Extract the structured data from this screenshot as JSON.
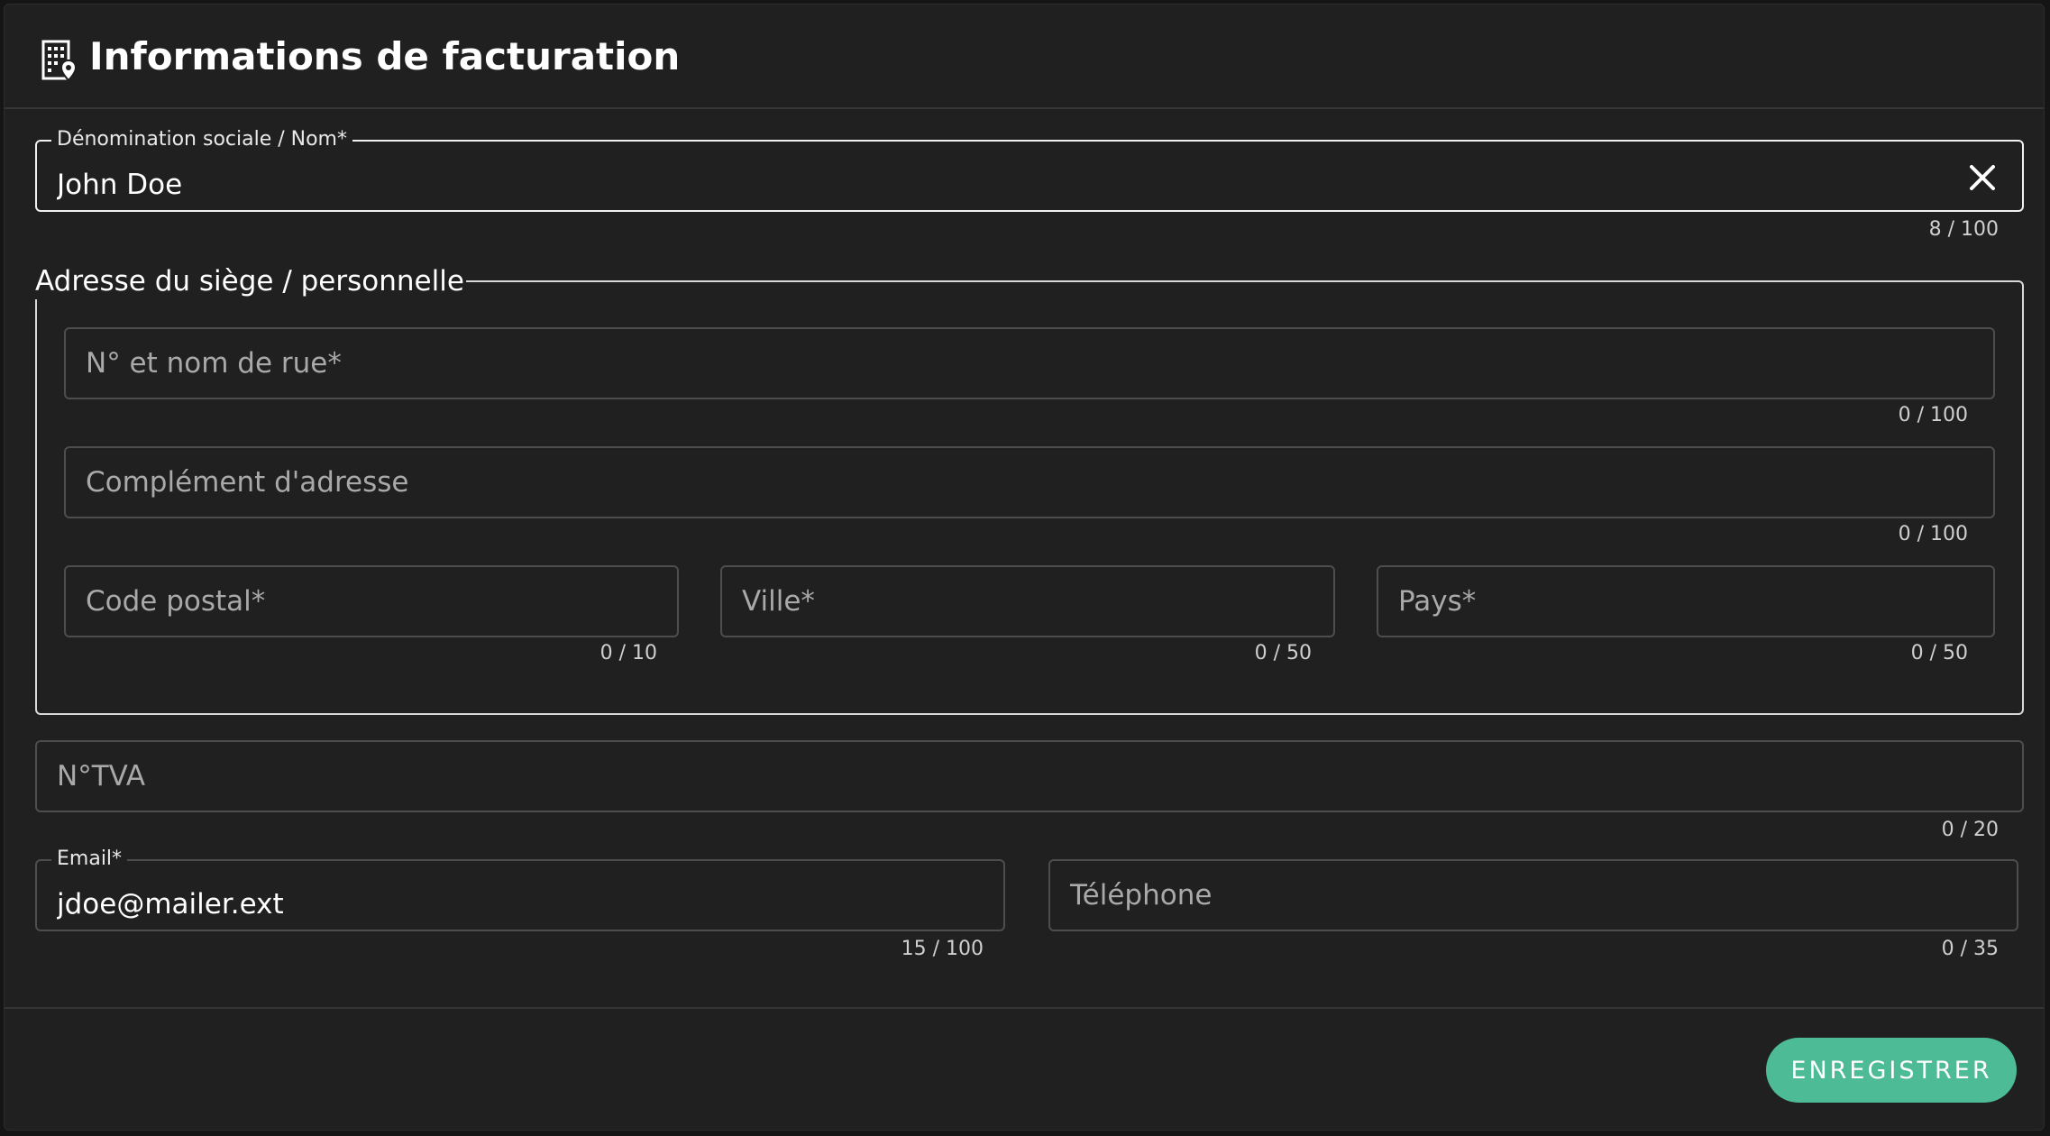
{
  "header": {
    "title": "Informations de facturation",
    "icon": "building-location-icon"
  },
  "fields": {
    "denomination": {
      "label": "Dénomination sociale / Nom*",
      "value": "John Doe",
      "counter": "8 / 100"
    },
    "address_group": {
      "legend": "Adresse du siège / personnelle"
    },
    "street": {
      "placeholder": "N° et nom de rue*",
      "value": "",
      "counter": "0 / 100"
    },
    "complement": {
      "placeholder": "Complément d'adresse",
      "value": "",
      "counter": "0 / 100"
    },
    "postal_code": {
      "placeholder": "Code postal*",
      "value": "",
      "counter": "0 / 10"
    },
    "city": {
      "placeholder": "Ville*",
      "value": "",
      "counter": "0 / 50"
    },
    "country": {
      "placeholder": "Pays*",
      "value": "",
      "counter": "0 / 50"
    },
    "vat": {
      "placeholder": "N°TVA",
      "value": "",
      "counter": "0 / 20"
    },
    "email": {
      "label": "Email*",
      "value": "jdoe@mailer.ext",
      "counter": "15 / 100"
    },
    "phone": {
      "placeholder": "Téléphone",
      "value": "",
      "counter": "0 / 35"
    }
  },
  "actions": {
    "save_label": "ENREGISTRER"
  },
  "colors": {
    "background": "#202020",
    "border": "#4d4d4d",
    "focus_border": "#f0f0f0",
    "accent": "#4dbb95"
  }
}
